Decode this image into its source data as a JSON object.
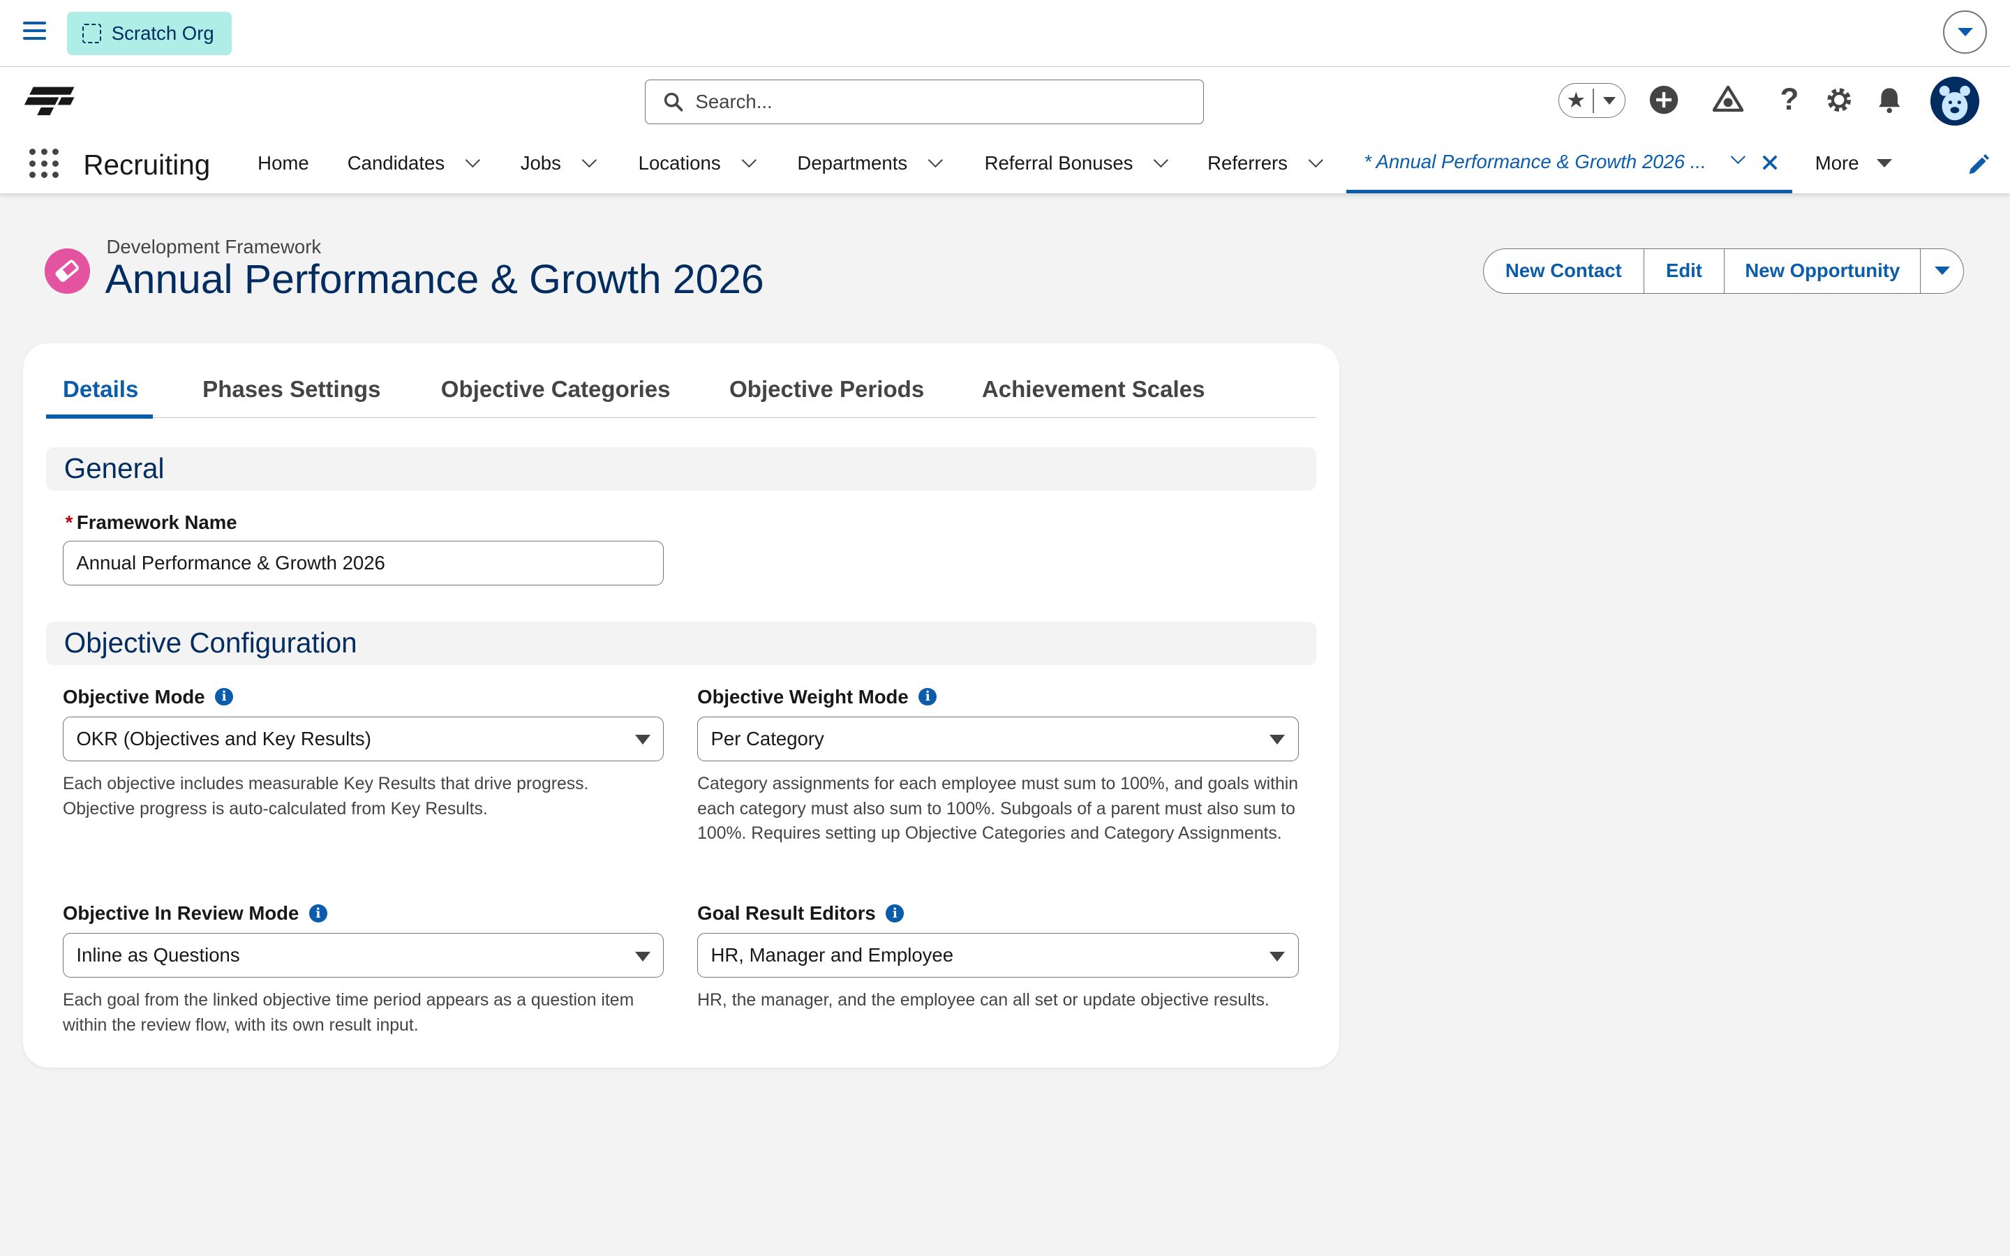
{
  "topbar": {
    "org_label": "Scratch Org"
  },
  "header": {
    "search_placeholder": "Search..."
  },
  "nav": {
    "app_name": "Recruiting",
    "items": [
      {
        "label": "Home",
        "has_menu": false
      },
      {
        "label": "Candidates",
        "has_menu": true
      },
      {
        "label": "Jobs",
        "has_menu": true
      },
      {
        "label": "Locations",
        "has_menu": true
      },
      {
        "label": "Departments",
        "has_menu": true
      },
      {
        "label": "Referral Bonuses",
        "has_menu": true
      },
      {
        "label": "Referrers",
        "has_menu": true
      }
    ],
    "active_tab": "* Annual Performance & Growth 2026 ...",
    "more_label": "More"
  },
  "record": {
    "type": "Development Framework",
    "title": "Annual Performance & Growth 2026",
    "actions": [
      "New Contact",
      "Edit",
      "New Opportunity"
    ]
  },
  "tabs": [
    "Details",
    "Phases Settings",
    "Objective Categories",
    "Objective Periods",
    "Achievement Scales"
  ],
  "general": {
    "heading": "General",
    "framework_name_label": "Framework Name",
    "framework_name_value": "Annual Performance & Growth 2026"
  },
  "objective_config": {
    "heading": "Objective Configuration",
    "mode": {
      "label": "Objective Mode",
      "value": "OKR (Objectives and Key Results)",
      "help": "Each objective includes measurable Key Results that drive progress. Objective progress is auto-calculated from Key Results."
    },
    "weight_mode": {
      "label": "Objective Weight Mode",
      "value": "Per Category",
      "help": "Category assignments for each employee must sum to 100%, and goals within each category must also sum to 100%. Subgoals of a parent must also sum to 100%. Requires setting up Objective Categories and Category Assignments."
    },
    "review_mode": {
      "label": "Objective In Review Mode",
      "value": "Inline as Questions",
      "help": "Each goal from the linked objective time period appears as a question item within the review flow, with its own result input."
    },
    "result_editors": {
      "label": "Goal Result Editors",
      "value": "HR, Manager and Employee",
      "help": "HR, the manager, and the employee can all set or update objective results."
    }
  },
  "colors": {
    "brand": "#0b5cab",
    "title": "#032d60",
    "org_badge": "#aeeee6",
    "record_icon": "#e3539f"
  }
}
